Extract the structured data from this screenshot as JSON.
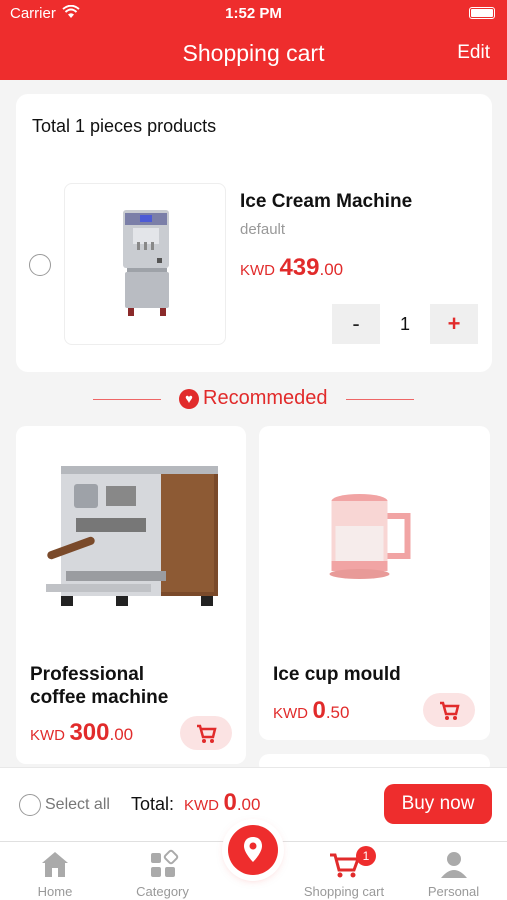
{
  "status_bar": {
    "carrier": "Carrier",
    "time": "1:52 PM"
  },
  "nav": {
    "title": "Shopping cart",
    "edit_label": "Edit"
  },
  "cart": {
    "total_text": "Total 1 pieces products",
    "items": [
      {
        "name": "Ice Cream Machine",
        "spec": "default",
        "currency": "KWD",
        "price_int": "439",
        "price_dec": ".00",
        "quantity": "1",
        "minus_label": "-",
        "plus_label": "+",
        "selected": false
      }
    ]
  },
  "recommended": {
    "title": "Recommeded",
    "products": [
      {
        "name_line1": "Professional",
        "name_line2": "coffee machine",
        "currency": "KWD",
        "price_int": "300",
        "price_dec": ".00"
      },
      {
        "name_line1": "Ice cup mould",
        "name_line2": "",
        "currency": "KWD",
        "price_int": "0",
        "price_dec": ".50"
      }
    ]
  },
  "checkout": {
    "select_all_label": "Select all",
    "total_label": "Total:",
    "currency": "KWD",
    "total_int": "0",
    "total_dec": ".00",
    "buy_label": "Buy now"
  },
  "tabs": [
    {
      "label": "Home",
      "icon": "home-icon",
      "active": false
    },
    {
      "label": "Category",
      "icon": "category-icon",
      "active": false
    },
    {
      "label": "",
      "icon": "location-pin-icon",
      "active": false
    },
    {
      "label": "Shopping cart",
      "icon": "cart-icon",
      "active": true,
      "badge": "1"
    },
    {
      "label": "Personal",
      "icon": "person-icon",
      "active": false
    }
  ],
  "colors": {
    "brand_red": "#ee2d2d",
    "price_red": "#e12b2b",
    "background": "#f4f4f4"
  }
}
